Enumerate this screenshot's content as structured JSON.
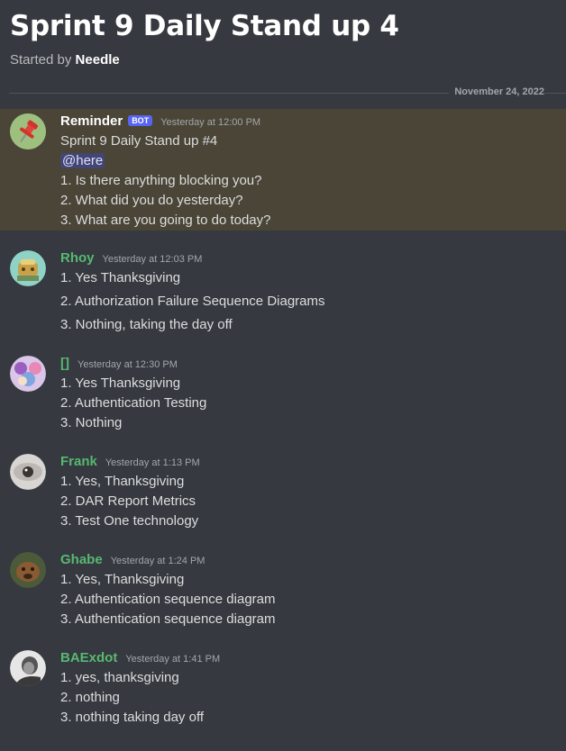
{
  "thread": {
    "title": "Sprint 9 Daily Stand up 4",
    "started_by_prefix": "Started by ",
    "started_by_name": "Needle"
  },
  "divider_date": "November 24, 2022",
  "messages": [
    {
      "author": "Reminder",
      "bot_tag": "BOT",
      "timestamp": "Yesterday at 12:00 PM",
      "lines": [
        "Sprint 9 Daily Stand up #4",
        "@here",
        "1. Is there anything blocking you?",
        "2. What did you do yesterday?",
        "3. What are you going to do today?"
      ]
    },
    {
      "author": "Rhoy",
      "timestamp": "Yesterday at 12:03 PM",
      "lines": [
        "1. Yes Thanksgiving",
        "2. Authorization Failure Sequence Diagrams",
        "3. Nothing, taking the day off"
      ]
    },
    {
      "author": "[]",
      "timestamp": "Yesterday at 12:30 PM",
      "lines": [
        "1. Yes Thanksgiving",
        "2. Authentication Testing",
        "3. Nothing"
      ]
    },
    {
      "author": "Frank",
      "timestamp": "Yesterday at 1:13 PM",
      "lines": [
        "1. Yes, Thanksgiving",
        "2. DAR Report Metrics",
        "3. Test One technology"
      ]
    },
    {
      "author": "Ghabe",
      "timestamp": "Yesterday at 1:24 PM",
      "lines": [
        "1. Yes, Thanksgiving",
        "2. Authentication sequence diagram",
        "3. Authentication sequence diagram"
      ]
    },
    {
      "author": "BAExdot",
      "timestamp": "Yesterday at 1:41 PM",
      "lines": [
        "1. yes, thanksgiving",
        "2. nothing",
        "3. nothing taking day off"
      ]
    }
  ],
  "colors": {
    "background": "#36393f",
    "highlight": "#4a4537",
    "author_green": "#57b971",
    "bot_tag": "#5865f2",
    "mention_bg": "#414675"
  }
}
